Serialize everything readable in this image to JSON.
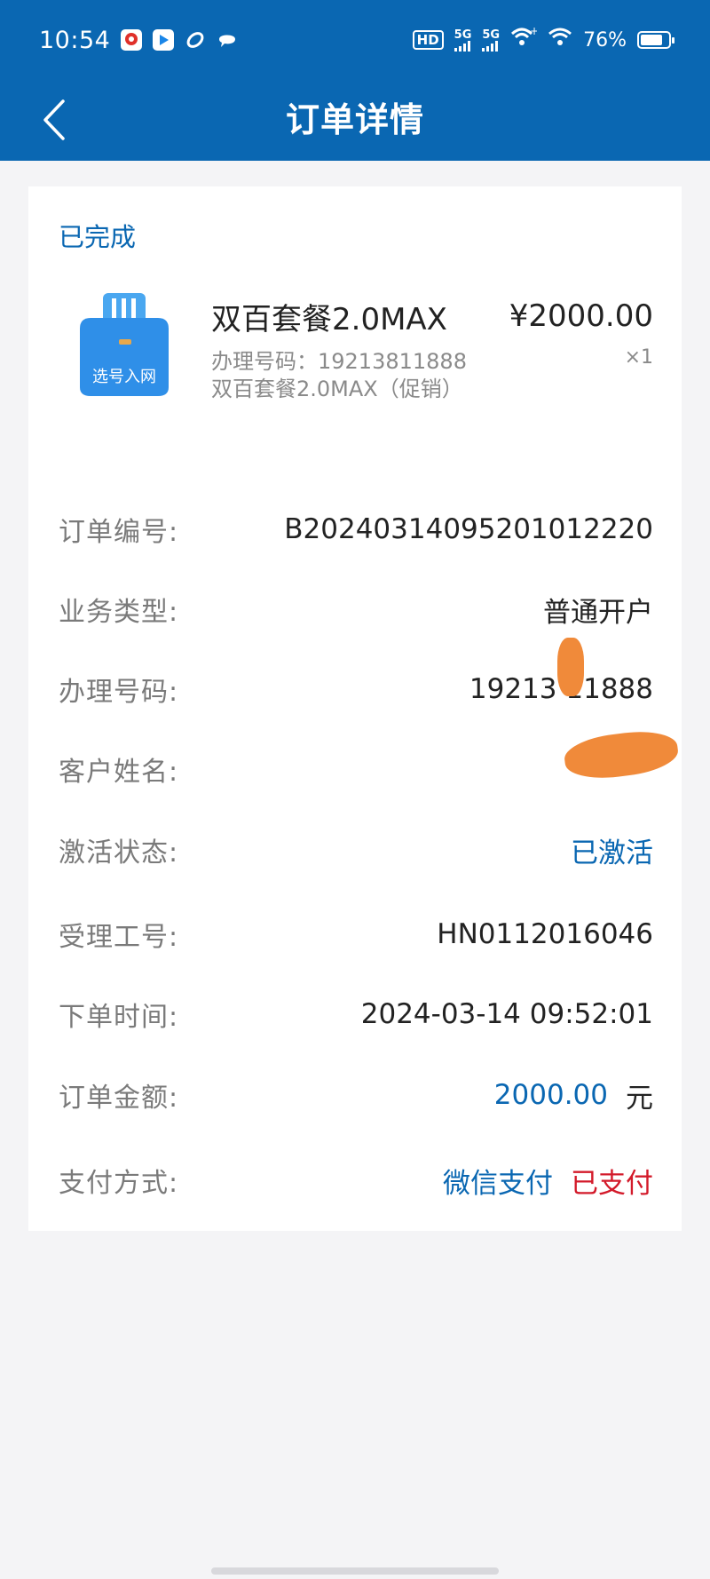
{
  "statusbar": {
    "time": "10:54",
    "hd": "HD",
    "signal1": "5G",
    "signal2": "5G",
    "battery": "76%",
    "battery_level": 0.76
  },
  "navbar": {
    "title": "订单详情",
    "back_icon": "chevron-left-icon"
  },
  "order": {
    "status": "已完成",
    "product": {
      "icon_label": "选号入网",
      "name": "双百套餐2.0MAX",
      "number_line": "办理号码：19213811888",
      "desc_line": "双百套餐2.0MAX（促销）",
      "price": "¥2000.00",
      "qty": "×1"
    },
    "details": [
      {
        "label": "订单编号:",
        "value": "B20240314095201012220"
      },
      {
        "label": "业务类型:",
        "value": "普通开户"
      },
      {
        "label": "办理号码:",
        "value": "19213 11888"
      },
      {
        "label": "客户姓名:",
        "value": ""
      },
      {
        "label": "激活状态:",
        "value": "已激活"
      },
      {
        "label": "受理工号:",
        "value": "HN0112016046"
      },
      {
        "label": "下单时间:",
        "value": "2024-03-14 09:52:01"
      },
      {
        "label": "订单金额:",
        "value": "2000.00",
        "unit": "元"
      },
      {
        "label": "支付方式:",
        "value": "微信支付",
        "status": "已支付"
      }
    ]
  },
  "colors": {
    "header": "#0a67b2",
    "accent": "#0a67b2",
    "paid": "#d31a2a",
    "redaction": "#f08a3a"
  }
}
